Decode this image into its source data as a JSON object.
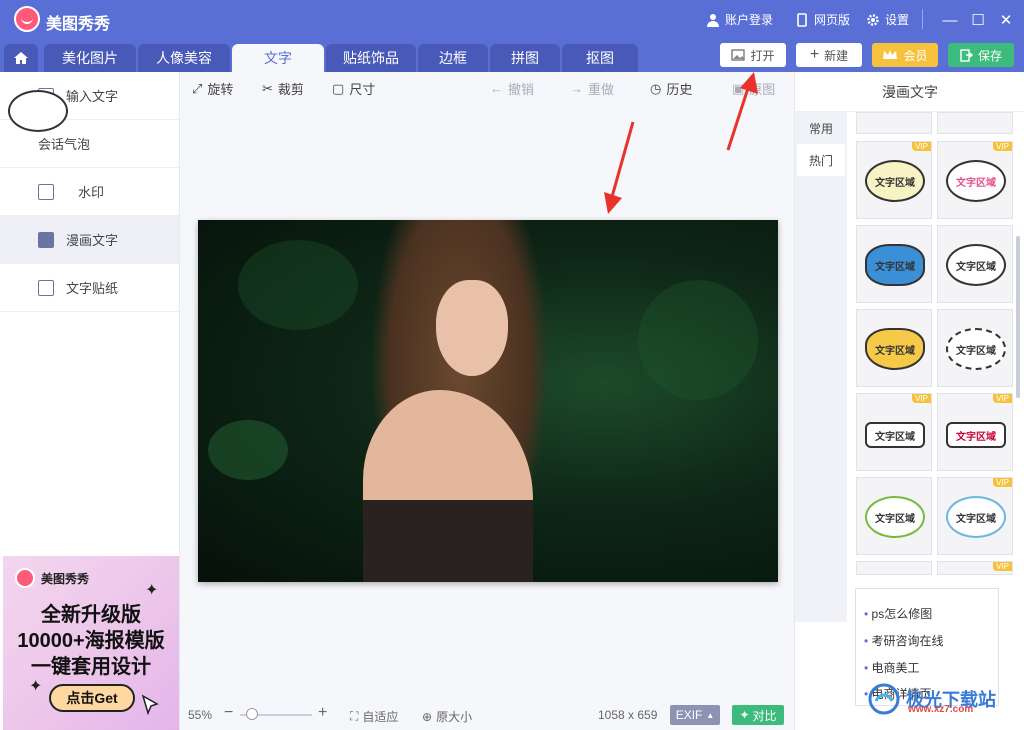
{
  "app": {
    "title": "美图秀秀"
  },
  "titlebar": {
    "login": "账户登录",
    "web": "网页版",
    "settings": "设置"
  },
  "tabs": [
    "美化图片",
    "人像美容",
    "文字",
    "贴纸饰品",
    "边框",
    "拼图",
    "抠图"
  ],
  "actions": {
    "open": "打开",
    "new": "新建",
    "member": "会员",
    "save": "保存"
  },
  "sidebar": {
    "items": [
      "输入文字",
      "会话气泡",
      "水印",
      "漫画文字",
      "文字贴纸"
    ],
    "active_index": 3
  },
  "toolbar": {
    "rotate": "旋转",
    "crop": "裁剪",
    "size": "尺寸",
    "undo": "撤销",
    "redo": "重做",
    "history": "历史",
    "original": "原图"
  },
  "status": {
    "zoom": "55%",
    "fit": "自适应",
    "original_size": "原大小",
    "dims": "1058 x 659",
    "exif": "EXIF",
    "compare": "对比"
  },
  "right_panel": {
    "title": "漫画文字",
    "categories": [
      "常用",
      "热门"
    ],
    "thumb_text": "文字区域",
    "vip_label": "VIP",
    "links": [
      "ps怎么修图",
      "考研咨询在线",
      "电商美工",
      "电商详情页"
    ]
  },
  "ad": {
    "brand": "美图秀秀",
    "line1": "全新升级版",
    "line2": "10000+海报模版",
    "line3": "一键套用设计",
    "cta": "点击Get"
  },
  "watermark": {
    "text": "极光下载站",
    "url": "www.xz7.com"
  },
  "colors": {
    "accent": "#5a6fd6",
    "tab_dark": "#4859b8",
    "member": "#f6c23e",
    "save": "#3dbb7d",
    "arrow": "#e8322b"
  }
}
